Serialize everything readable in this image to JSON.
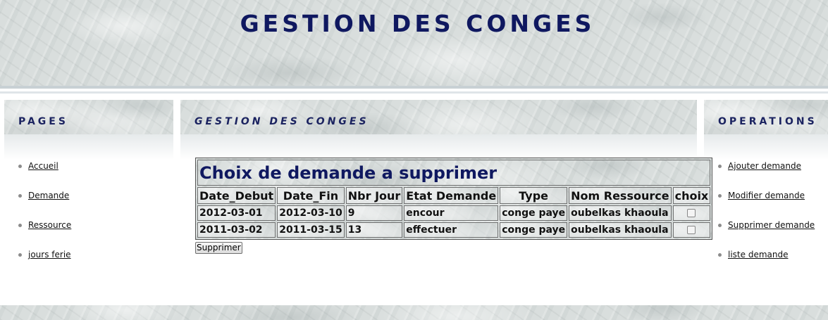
{
  "header": {
    "title": "GESTION DES CONGES"
  },
  "left_panel": {
    "heading": "PAGES",
    "items": [
      {
        "label": "Accueil"
      },
      {
        "label": "Demande"
      },
      {
        "label": "Ressource"
      },
      {
        "label": "jours ferie"
      }
    ]
  },
  "center_panel": {
    "heading": "GESTION DES CONGES"
  },
  "right_panel": {
    "heading": "OPERATIONS",
    "items": [
      {
        "label": "Ajouter demande"
      },
      {
        "label": "Modifier demande"
      },
      {
        "label": "Supprimer demande"
      },
      {
        "label": "liste demande"
      }
    ]
  },
  "table": {
    "caption": "Choix de demande a supprimer",
    "columns": [
      "Date_Debut",
      "Date_Fin",
      "Nbr Jour",
      "Etat Demande",
      "Type",
      "Nom Ressource",
      "choix"
    ],
    "rows": [
      {
        "date_debut": "2012-03-01",
        "date_fin": "2012-03-10",
        "nbr_jour": "9",
        "etat": "encour",
        "type": "conge paye",
        "ressource": "oubelkas khaoula",
        "checked": false
      },
      {
        "date_debut": "2011-03-02",
        "date_fin": "2011-03-15",
        "nbr_jour": "13",
        "etat": "effectuer",
        "type": "conge paye",
        "ressource": "oubelkas khaoula",
        "checked": false
      }
    ]
  },
  "actions": {
    "delete_label": "Supprimer"
  },
  "colors": {
    "title_navy": "#0f1860",
    "heading_navy": "#1b2360",
    "marble": "#d9dedd"
  }
}
